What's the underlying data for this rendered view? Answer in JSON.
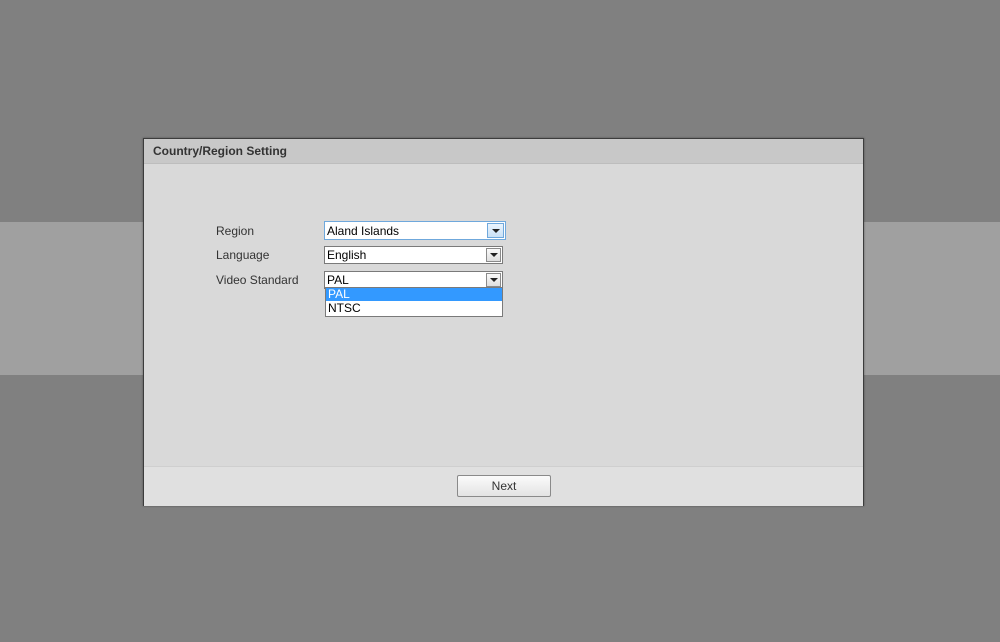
{
  "dialog": {
    "title": "Country/Region Setting"
  },
  "form": {
    "region": {
      "label": "Region",
      "value": "Aland Islands"
    },
    "language": {
      "label": "Language",
      "value": "English"
    },
    "video_standard": {
      "label": "Video Standard",
      "value": "PAL",
      "options": [
        "PAL",
        "NTSC"
      ],
      "highlighted_option": "PAL"
    }
  },
  "footer": {
    "next_label": "Next"
  },
  "icons": {
    "select_arrow": "chevron-down-icon"
  },
  "colors": {
    "page_background": "#808080",
    "band_background": "#a0a0a0",
    "dialog_background": "#d9d9d9",
    "header_background": "#c8c8c8",
    "highlight": "#3399ff",
    "focus_border": "#6fa8dc"
  }
}
